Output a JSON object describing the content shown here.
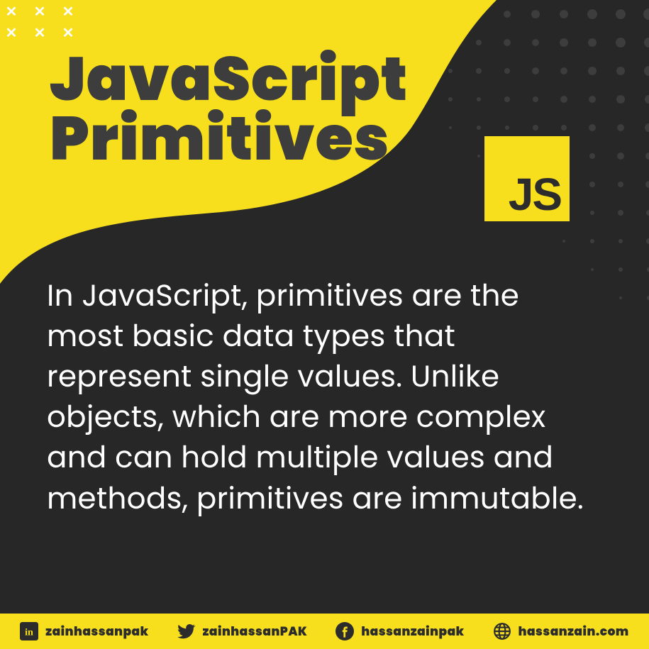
{
  "title_line1": "JavaScript",
  "title_line2": "Primitives",
  "js_logo_text": "JS",
  "body": "In JavaScript, primitives are the most basic data types that represent single values. Unlike objects, which are more complex and can hold multiple values and methods, primitives are immutable.",
  "footer": {
    "linkedin": "zainhassanpak",
    "twitter": "zainhassanPAK",
    "facebook": "hassanzainpak",
    "website": "hassanzain.com"
  },
  "colors": {
    "yellow": "#F7DF1E",
    "dark": "#272727",
    "white": "#ffffff"
  }
}
